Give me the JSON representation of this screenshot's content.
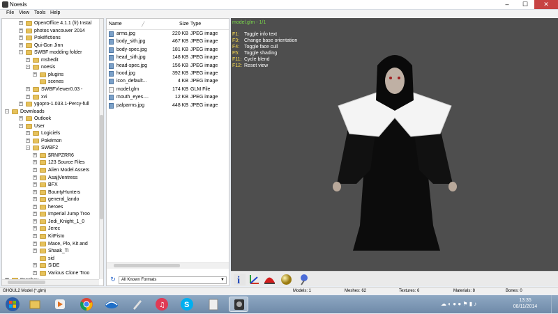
{
  "window": {
    "title": "Noesis",
    "minimize": "–",
    "maximize": "☐",
    "close": "✕"
  },
  "menu": [
    "File",
    "View",
    "Tools",
    "Help"
  ],
  "tree": [
    {
      "label": "OpenOffice 4.1.1 (fr) Instal",
      "exp": "+"
    },
    {
      "label": "photos vancouver 2014",
      "exp": "+"
    },
    {
      "label": "Pokéfictions",
      "exp": "+"
    },
    {
      "label": "Qui-Gon Jinn",
      "exp": "+"
    },
    {
      "label": "SWBF modding folder",
      "exp": "-"
    },
    {
      "label": "mshedit",
      "exp": "+"
    },
    {
      "label": "noesis",
      "exp": "-"
    },
    {
      "label": "plugins",
      "exp": "+"
    },
    {
      "label": "scenes",
      "exp": ""
    },
    {
      "label": "SWBFViewer0.03 -",
      "exp": "+"
    },
    {
      "label": "xvi",
      "exp": "+"
    },
    {
      "label": "ygopro-1.033.1-Percy-full",
      "exp": "+"
    },
    {
      "label": "Downloads",
      "exp": "-"
    },
    {
      "label": "Outlook",
      "exp": "+"
    },
    {
      "label": "User",
      "exp": "-"
    },
    {
      "label": "Logiciels",
      "exp": "+"
    },
    {
      "label": "Pokémon",
      "exp": "+"
    },
    {
      "label": "SWBF2",
      "exp": "-"
    },
    {
      "label": "$RNPZRR6",
      "exp": "+"
    },
    {
      "label": "123 Source Files",
      "exp": "+"
    },
    {
      "label": "Alien Model Assets",
      "exp": "+"
    },
    {
      "label": "AsajjVentress",
      "exp": "+"
    },
    {
      "label": "BFX",
      "exp": "+"
    },
    {
      "label": "BountyHunters",
      "exp": "+"
    },
    {
      "label": "general_lando",
      "exp": "+"
    },
    {
      "label": "heroes",
      "exp": "+"
    },
    {
      "label": "Imperial Jump Troo",
      "exp": "+"
    },
    {
      "label": "Jedi_Knight_1_0",
      "exp": "+"
    },
    {
      "label": "Jerec",
      "exp": "+"
    },
    {
      "label": "KitFisto",
      "exp": "+"
    },
    {
      "label": "Mace, Plo, Kit and",
      "exp": "+"
    },
    {
      "label": "Shaak_Ti",
      "exp": "+"
    },
    {
      "label": "sid",
      "exp": ""
    },
    {
      "label": "SIDE",
      "exp": "+"
    },
    {
      "label": "Various Clone Troo",
      "exp": "+"
    },
    {
      "label": "Dropbox",
      "exp": "+"
    }
  ],
  "files": {
    "headers": {
      "name": "Name",
      "size": "Size",
      "type": "Type"
    },
    "rows": [
      {
        "name": "arms.jpg",
        "size": "220 KB",
        "type": "JPEG image",
        "icon": "jpg"
      },
      {
        "name": "body_sith.jpg",
        "size": "467 KB",
        "type": "JPEG image",
        "icon": "jpg"
      },
      {
        "name": "body-spec.jpg",
        "size": "181 KB",
        "type": "JPEG image",
        "icon": "jpg"
      },
      {
        "name": "head_sith.jpg",
        "size": "148 KB",
        "type": "JPEG image",
        "icon": "jpg"
      },
      {
        "name": "head-spec.jpg",
        "size": "156 KB",
        "type": "JPEG image",
        "icon": "jpg"
      },
      {
        "name": "hood.jpg",
        "size": "392 KB",
        "type": "JPEG image",
        "icon": "jpg"
      },
      {
        "name": "icon_default...",
        "size": "4 KB",
        "type": "JPEG image",
        "icon": "jpg"
      },
      {
        "name": "model.glm",
        "size": "174 KB",
        "type": "GLM File",
        "icon": "glm"
      },
      {
        "name": "mouth_eyes....",
        "size": "12 KB",
        "type": "JPEG image",
        "icon": "jpg"
      },
      {
        "name": "palparms.jpg",
        "size": "448 KB",
        "type": "JPEG image",
        "icon": "jpg"
      }
    ],
    "format_filter": "All Known Formats"
  },
  "viewport": {
    "title": "model.glm - 1/1",
    "keys": [
      {
        "key": "F1:",
        "desc": "Toggle info text"
      },
      {
        "key": "F3:",
        "desc": "Change base orientation"
      },
      {
        "key": "F4:",
        "desc": "Toggle face cull"
      },
      {
        "key": "F5:",
        "desc": "Toggle shading"
      },
      {
        "key": "F11:",
        "desc": "Cycle blend"
      },
      {
        "key": "F12:",
        "desc": "Reset view"
      }
    ]
  },
  "status": {
    "model_type": "GHOUL2 Model (*.glm)",
    "models": "Models: 1",
    "meshes": "Meshes: 62",
    "textures": "Textures: 6",
    "materials": "Materials: 8",
    "bones": "Bones: 0"
  },
  "clock": {
    "time": "13:35",
    "date": "08/11/2014"
  }
}
